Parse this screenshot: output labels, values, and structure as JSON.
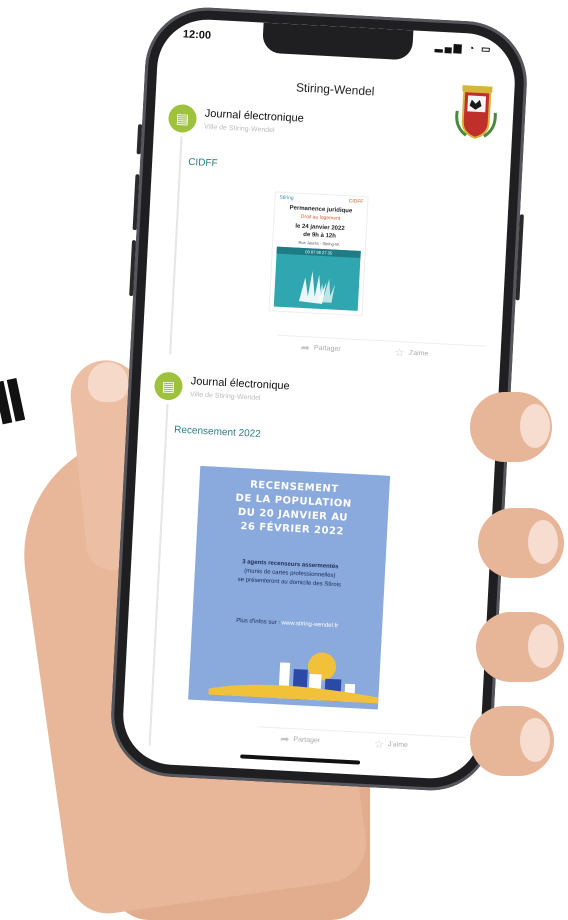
{
  "status_bar": {
    "time": "12:00",
    "indicators": "signal wifi battery"
  },
  "header": {
    "title": "Stiring-Wendel"
  },
  "posts": [
    {
      "author": "Journal électronique",
      "subtitle": "Ville de Stiring-Wendel",
      "text": "CIDFF",
      "poster": {
        "logo_left": "Stiring",
        "logo_right": "CIDFF",
        "heading": "Permanence juridique",
        "sub": "Droit au logement",
        "date": "le 24 janvier 2022",
        "hours": "de 9h à 12h",
        "address": "Rue Jaurès - Stiring-W.",
        "phone": "03 87 88 27 35"
      },
      "actions": {
        "share": "Partager",
        "like": "J'aime"
      }
    },
    {
      "author": "Journal électronique",
      "subtitle": "Ville de Stiring-Wendel",
      "text": "Recensement 2022",
      "poster": {
        "line1": "RECENSEMENT",
        "line2": "DE LA POPULATION",
        "line3": "DU 20 JANVIER AU",
        "line4": "26 FÉVRIER 2022",
        "body1": "3 agents recenseurs assermentés",
        "body2": "(munis de cartes professionnelles)",
        "body3": "se présenteront au domicile des Stirois",
        "link_prefix": "Plus d'infos sur :",
        "link": "www.stiring-wendel.fr"
      },
      "actions": {
        "share": "Partager",
        "like": "J'aime"
      }
    }
  ],
  "background_text": "ll",
  "colors": {
    "accent_green": "#9fc23c",
    "teal_text": "#2a7e8c",
    "poster_blue": "#8aa9dc"
  }
}
